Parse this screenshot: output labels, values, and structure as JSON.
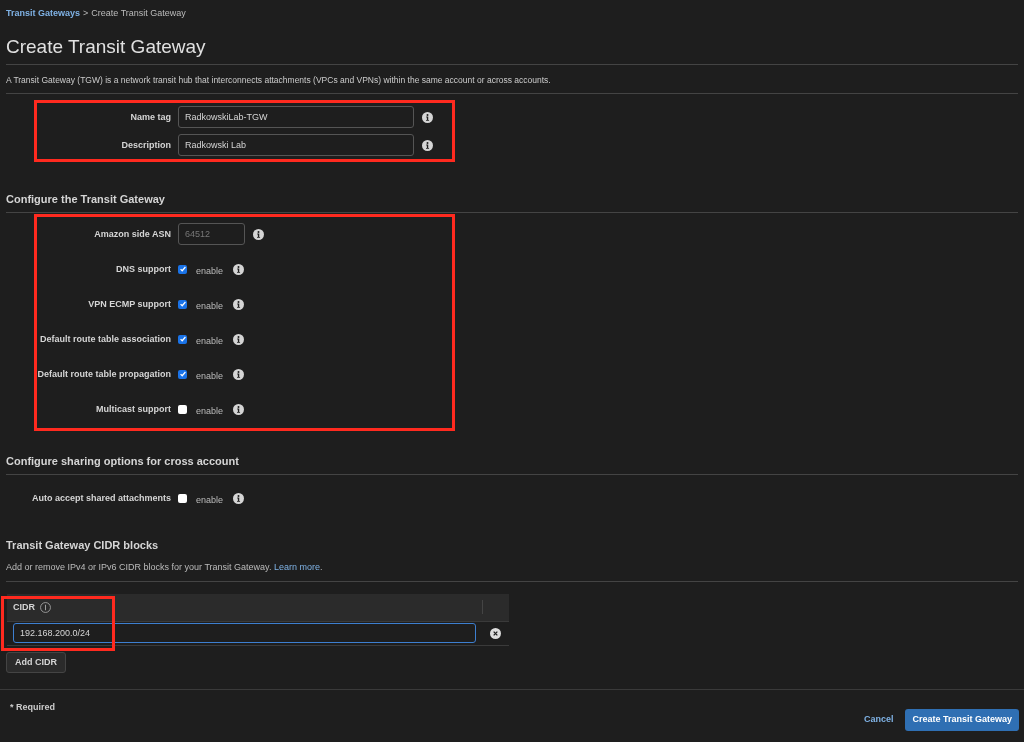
{
  "breadcrumb": {
    "link": "Transit Gateways",
    "separator": ">",
    "current": "Create Transit Gateway"
  },
  "page_title": "Create Transit Gateway",
  "description": "A Transit Gateway (TGW) is a network transit hub that interconnects attachments (VPCs and VPNs) within the same account or across accounts.",
  "identity": {
    "highlighted": true,
    "fields": [
      {
        "kind": "text",
        "label": "Name tag",
        "value": "RadkowskiLab-TGW"
      },
      {
        "kind": "text",
        "label": "Description",
        "value": "Radkowski Lab"
      }
    ]
  },
  "configure": {
    "title": "Configure the Transit Gateway",
    "highlighted": true,
    "fields": [
      {
        "kind": "short",
        "label": "Amazon side ASN",
        "placeholder": "64512"
      },
      {
        "kind": "checkbox",
        "label": "DNS support",
        "checked": true,
        "option": "enable"
      },
      {
        "kind": "checkbox",
        "label": "VPN ECMP support",
        "checked": true,
        "option": "enable"
      },
      {
        "kind": "checkbox",
        "label": "Default route table association",
        "checked": true,
        "option": "enable"
      },
      {
        "kind": "checkbox",
        "label": "Default route table propagation",
        "checked": true,
        "option": "enable"
      },
      {
        "kind": "checkbox",
        "label": "Multicast support",
        "checked": false,
        "option": "enable"
      }
    ]
  },
  "sharing": {
    "title": "Configure sharing options for cross account",
    "highlighted": false,
    "fields": [
      {
        "kind": "checkbox",
        "label": "Auto accept shared attachments",
        "checked": false,
        "option": "enable"
      }
    ]
  },
  "cidr": {
    "title": "Transit Gateway CIDR blocks",
    "description": "Add or remove IPv4 or IPv6 CIDR blocks for your Transit Gateway.",
    "link": "Learn more",
    "link_suffix": ".",
    "column": "CIDR",
    "highlighted": true,
    "rows": [
      {
        "value": "192.168.200.0/24"
      }
    ],
    "add_button": "Add CIDR"
  },
  "footer": {
    "required": "* Required",
    "cancel": "Cancel",
    "submit": "Create Transit Gateway"
  }
}
